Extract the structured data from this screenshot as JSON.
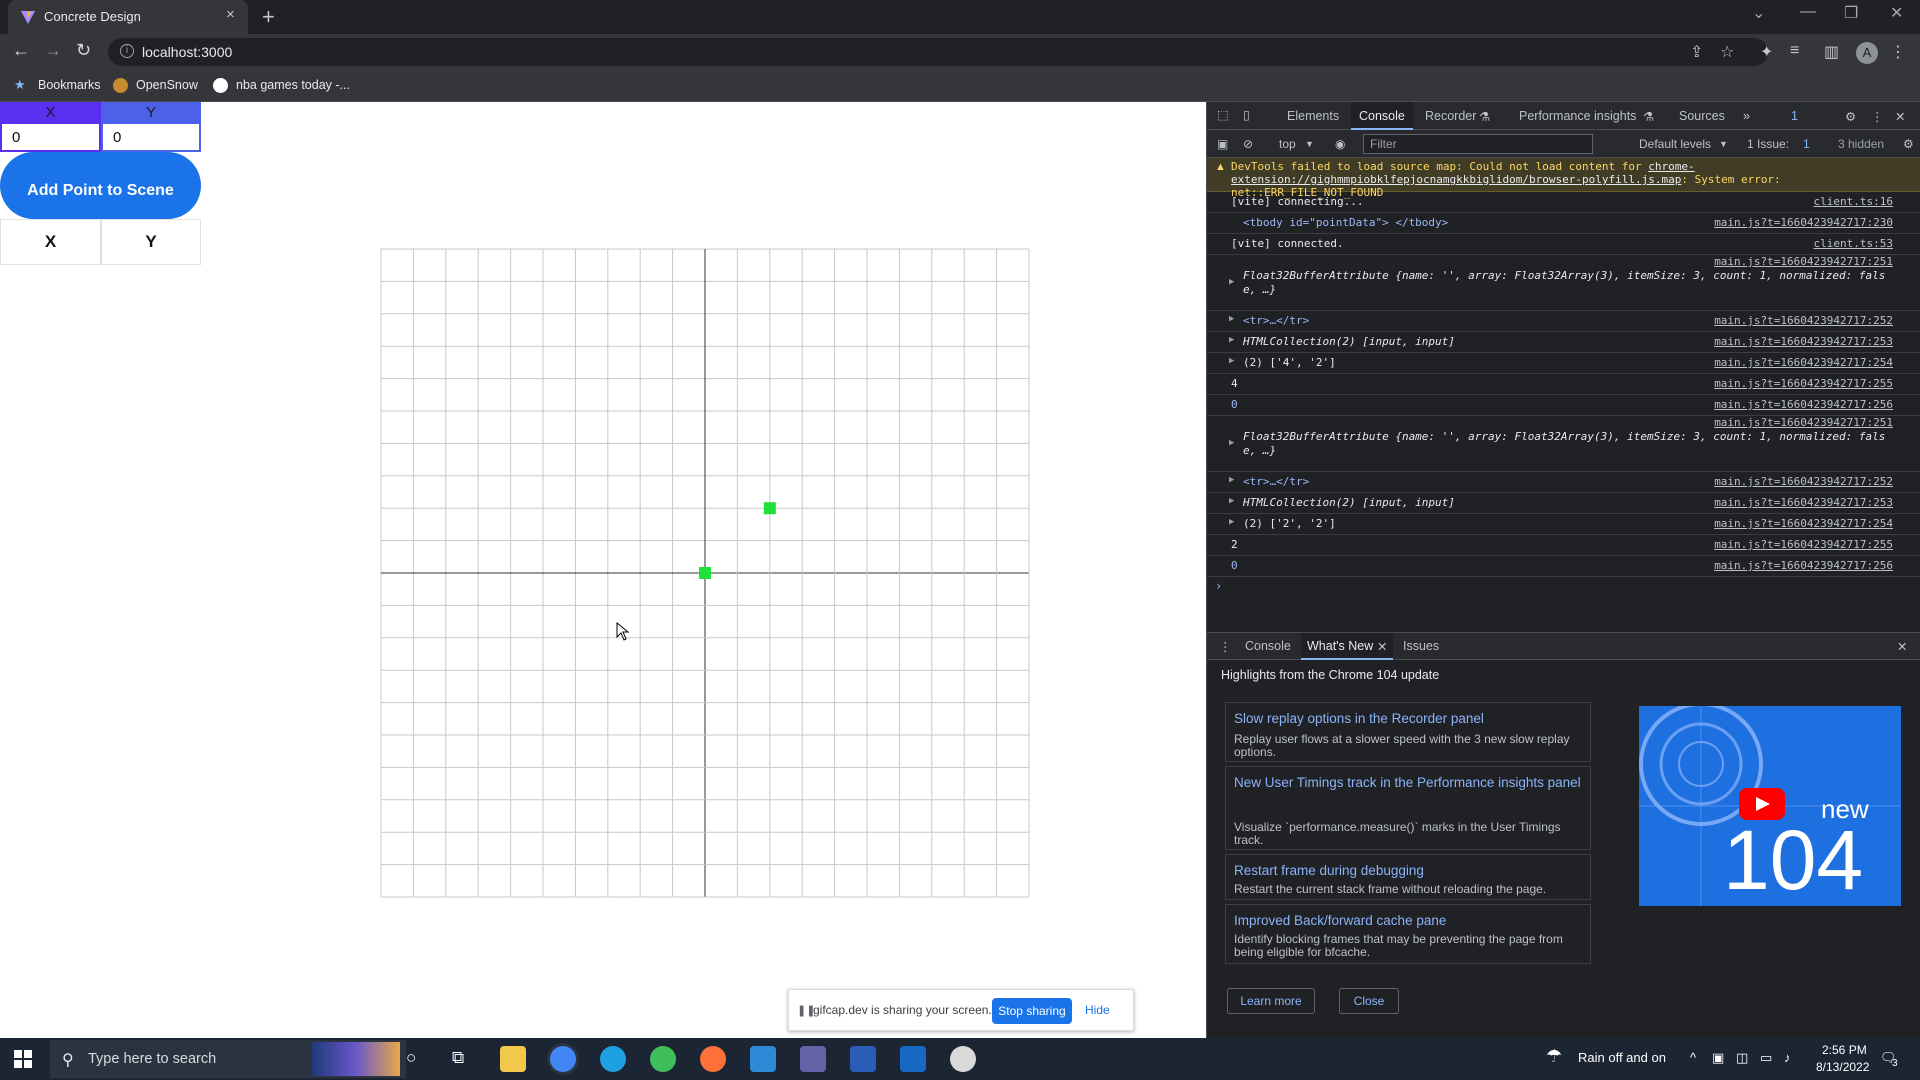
{
  "browser": {
    "tab_title": "Concrete Design",
    "tab_close": "×",
    "new_tab": "+",
    "url": "localhost:3000",
    "bookmarks": [
      "Bookmarks",
      "OpenSnow",
      "nba games today -..."
    ]
  },
  "app": {
    "x_header": "X",
    "y_header": "Y",
    "x_value": "0",
    "y_value": "0",
    "add_button": "Add Point to Scene",
    "table_headers": [
      "X",
      "Y"
    ],
    "grid": {
      "divisions": 20,
      "range": [
        -10,
        10
      ],
      "points": [
        {
          "x": 0,
          "y": 0
        },
        {
          "x": 2,
          "y": 2
        }
      ],
      "point_color": "#22e03a"
    }
  },
  "share_bar": {
    "message": "gifcap.dev is sharing your screen.",
    "stop": "Stop sharing",
    "hide": "Hide"
  },
  "devtools": {
    "tabs": [
      "Elements",
      "Console",
      "Recorder",
      "Performance insights",
      "Sources"
    ],
    "issues_badge": "1",
    "context": "top",
    "filter_placeholder": "Filter",
    "levels": "Default levels",
    "issue_count": "1 Issue:",
    "issue_num": "1",
    "hidden": "3 hidden",
    "warning": {
      "text_a": "DevTools failed to load source map: Could not load content for ",
      "link": "chrome-extension://gighmmpiobklfepjocnamgkkbiglidom/browser-polyfill.js.map",
      "text_b": ": System error: net::ERR_FILE_NOT_FOUND"
    },
    "rows": [
      {
        "msg": "[vite] connecting...",
        "src": "client.ts:16"
      },
      {
        "msg": "<tbody id=\"pointData\"> </tbody>",
        "src": "main.js?t=1660423942717:230"
      },
      {
        "msg": "[vite] connected.",
        "src": "client.ts:53"
      },
      {
        "msg_a": "Float32BufferAttribute {name: '', array: Float32Array(3), itemSize: 3, count: 1, normalized: fals",
        "msg_b": "e, …}",
        "src": "main.js?t=1660423942717:251"
      },
      {
        "msg": "<tr>…</tr>",
        "src": "main.js?t=1660423942717:252"
      },
      {
        "msg": "HTMLCollection(2) [input, input]",
        "src": "main.js?t=1660423942717:253"
      },
      {
        "msg": "(2) ['4', '2']",
        "src": "main.js?t=1660423942717:254"
      },
      {
        "msg": "4",
        "src": "main.js?t=1660423942717:255"
      },
      {
        "msg": "0",
        "src": "main.js?t=1660423942717:256"
      },
      {
        "msg_a": "Float32BufferAttribute {name: '', array: Float32Array(3), itemSize: 3, count: 1, normalized: fals",
        "msg_b": "e, …}",
        "src": "main.js?t=1660423942717:251"
      },
      {
        "msg": "<tr>…</tr>",
        "src": "main.js?t=1660423942717:252"
      },
      {
        "msg": "HTMLCollection(2) [input, input]",
        "src": "main.js?t=1660423942717:253"
      },
      {
        "msg": "(2) ['2', '2']",
        "src": "main.js?t=1660423942717:254"
      },
      {
        "msg": "2",
        "src": "main.js?t=1660423942717:255"
      },
      {
        "msg": "0",
        "src": "main.js?t=1660423942717:256"
      }
    ],
    "prompt": "›",
    "drawer_tabs": [
      "Console",
      "What's New",
      "Issues"
    ],
    "whats_new_heading": "Highlights from the Chrome 104 update",
    "cards": [
      {
        "title": "Slow replay options in the Recorder panel",
        "desc": "Replay user flows at a slower speed with the 3 new slow replay options."
      },
      {
        "title": "New User Timings track in the Performance insights panel",
        "desc": "Visualize `performance.measure()` marks in the User Timings track."
      },
      {
        "title": "Restart frame during debugging",
        "desc": "Restart the current stack frame without reloading the page."
      },
      {
        "title": "Improved Back/forward cache pane",
        "desc": "Identify blocking frames that may be preventing the page from being eligible for bfcache."
      }
    ],
    "thumb_new": "new",
    "thumb_version": "104",
    "learn_more": "Learn more",
    "close": "Close"
  },
  "taskbar": {
    "search_placeholder": "Type here to search",
    "weather": "Rain off and on",
    "time": "2:56 PM",
    "date": "8/13/2022",
    "notifications": "3"
  }
}
